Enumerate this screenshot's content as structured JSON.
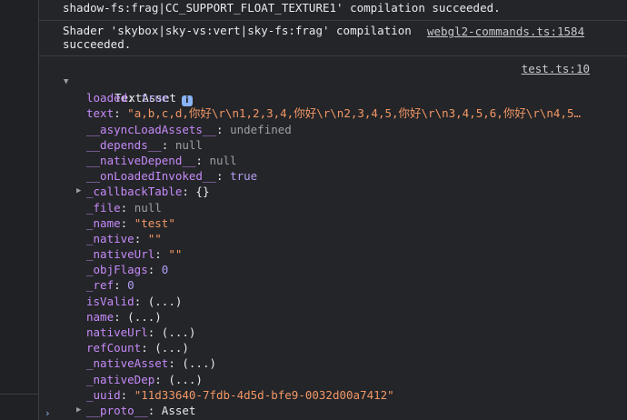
{
  "console": {
    "messages": [
      {
        "text": "shadow-fs:frag|CC_SUPPORT_FLOAT_TEXTURE1' compilation succeeded."
      },
      {
        "line1": "Shader 'skybox|sky-vs:vert|sky-fs:frag' compilation ",
        "link": "webgl2-commands.ts:1584",
        "line2": "succeeded."
      }
    ],
    "object": {
      "source_link": "test.ts:10",
      "title": "TextAsset",
      "info_icon": "i",
      "properties": [
        {
          "key": "loaded",
          "value": "true",
          "type": "bool",
          "expandable": false
        },
        {
          "key": "text",
          "value": "\"a,b,c,d,你好\\r\\n1,2,3,4,你好\\r\\n2,3,4,5,你好\\r\\n3,4,5,6,你好\\r\\n4,5…",
          "type": "str",
          "expandable": false
        },
        {
          "key": "__asyncLoadAssets__",
          "value": "undefined",
          "type": "undef",
          "expandable": false
        },
        {
          "key": "__depends__",
          "value": "null",
          "type": "null",
          "expandable": false
        },
        {
          "key": "__nativeDepend__",
          "value": "null",
          "type": "null",
          "expandable": false
        },
        {
          "key": "__onLoadedInvoked__",
          "value": "true",
          "type": "bool",
          "expandable": false
        },
        {
          "key": "_callbackTable",
          "value": "{}",
          "type": "obj",
          "expandable": true
        },
        {
          "key": "_file",
          "value": "null",
          "type": "null",
          "expandable": false
        },
        {
          "key": "_name",
          "value": "\"test\"",
          "type": "str",
          "expandable": false
        },
        {
          "key": "_native",
          "value": "\"\"",
          "type": "str",
          "expandable": false
        },
        {
          "key": "_nativeUrl",
          "value": "\"\"",
          "type": "str",
          "expandable": false
        },
        {
          "key": "_objFlags",
          "value": "0",
          "type": "num",
          "expandable": false
        },
        {
          "key": "_ref",
          "value": "0",
          "type": "num",
          "expandable": false
        },
        {
          "key": "isValid",
          "value": "(...)",
          "type": "obj",
          "expandable": false
        },
        {
          "key": "name",
          "value": "(...)",
          "type": "obj",
          "expandable": false
        },
        {
          "key": "nativeUrl",
          "value": "(...)",
          "type": "obj",
          "expandable": false
        },
        {
          "key": "refCount",
          "value": "(...)",
          "type": "obj",
          "expandable": false
        },
        {
          "key": "_nativeAsset",
          "value": "(...)",
          "type": "obj",
          "expandable": false
        },
        {
          "key": "_nativeDep",
          "value": "(...)",
          "type": "obj",
          "expandable": false
        },
        {
          "key": "_uuid",
          "value": "\"11d33640-7fdb-4d5d-bfe9-0032d00a7412\"",
          "type": "str",
          "expandable": false
        },
        {
          "key": "__proto__",
          "value": "Asset",
          "type": "obj",
          "expandable": true
        }
      ]
    },
    "prompt_symbol": "›"
  }
}
